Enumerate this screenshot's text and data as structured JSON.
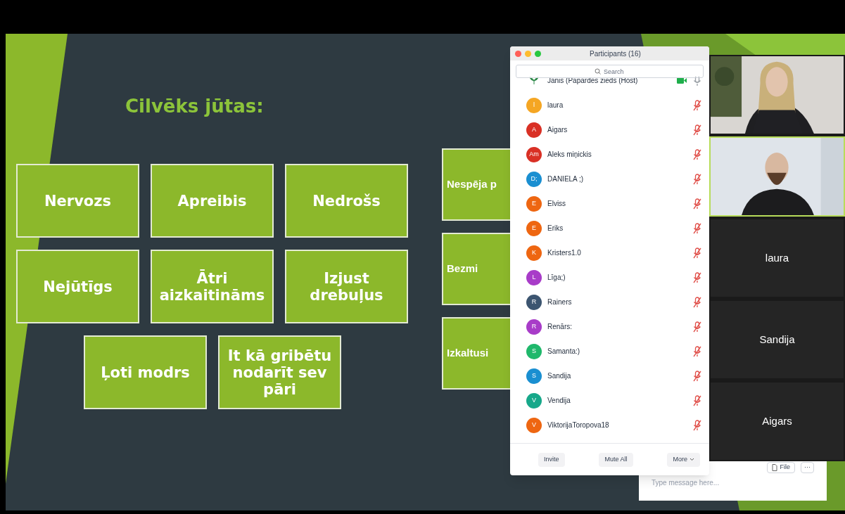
{
  "slide": {
    "title": "Cilvēks jūtas:",
    "cards": [
      [
        "Nervozs",
        "Apreibis",
        "Nedrošs"
      ],
      [
        "Nejūtīgs",
        "Ātri aizkaitināms",
        "Izjust drebuļus"
      ],
      [
        "Ļoti modrs",
        "It kā gribētu nodarīt sev pāri"
      ]
    ],
    "side_cards": [
      "Nespēja p",
      "Bezmi",
      "Izkaltusi"
    ]
  },
  "participants": {
    "title": "Participants (16)",
    "search": {
      "placeholder": "Search"
    },
    "list": [
      {
        "name": "Janis (Papardes zieds (Host)",
        "kind": "logo",
        "muted": false,
        "video_on": true
      },
      {
        "name": "laura",
        "initials": "l",
        "kind": "initials",
        "color": "#f5a623",
        "muted": true,
        "video_on": false
      },
      {
        "name": "Aigars",
        "initials": "A",
        "kind": "initials",
        "color": "#d93025",
        "muted": true,
        "video_on": false
      },
      {
        "name": "Aleks miņickis",
        "initials": "Am",
        "kind": "initials",
        "color": "#d93025",
        "muted": true,
        "video_on": false
      },
      {
        "name": "DANIELA ;)",
        "initials": "D;",
        "kind": "initials",
        "color": "#1a8fd1",
        "muted": true,
        "video_on": false
      },
      {
        "name": "Elviss",
        "initials": "E",
        "kind": "initials",
        "color": "#ee6611",
        "muted": true,
        "video_on": false
      },
      {
        "name": "Eriks",
        "initials": "E",
        "kind": "initials",
        "color": "#ee6611",
        "muted": true,
        "video_on": false
      },
      {
        "name": "Kristers1.0",
        "initials": "K",
        "kind": "initials",
        "color": "#ee6611",
        "muted": true,
        "video_on": false
      },
      {
        "name": "Līga;)",
        "initials": "L",
        "kind": "initials",
        "color": "#a83cc8",
        "muted": true,
        "video_on": false
      },
      {
        "name": "Rainers",
        "initials": "R",
        "kind": "initials",
        "color": "#3c5570",
        "muted": true,
        "video_on": false
      },
      {
        "name": "Renārs:",
        "initials": "R",
        "kind": "initials",
        "color": "#a83cc8",
        "muted": true,
        "video_on": false
      },
      {
        "name": "Samanta:)",
        "initials": "S",
        "kind": "initials",
        "color": "#1fb86b",
        "muted": true,
        "video_on": false
      },
      {
        "name": "Sandija",
        "initials": "S",
        "kind": "initials",
        "color": "#1a8fd1",
        "muted": true,
        "video_on": false
      },
      {
        "name": "Vendija",
        "initials": "V",
        "kind": "initials",
        "color": "#17a88a",
        "muted": true,
        "video_on": false
      },
      {
        "name": "ViktorijaToropova18",
        "initials": "V",
        "kind": "initials",
        "color": "#ee6611",
        "muted": true,
        "video_on": false
      }
    ],
    "buttons": [
      "Invite",
      "Mute All",
      "More"
    ]
  },
  "videos": [
    {
      "kind": "picture",
      "selected": false
    },
    {
      "kind": "picture",
      "selected": true
    },
    {
      "kind": "name",
      "name": "laura",
      "selected": false
    },
    {
      "kind": "name",
      "name": "Sandija",
      "selected": false
    },
    {
      "kind": "name",
      "name": "Aigars",
      "selected": false
    }
  ],
  "chat": {
    "buttons": [
      "File",
      "···"
    ],
    "placeholder": "Type message here..."
  }
}
